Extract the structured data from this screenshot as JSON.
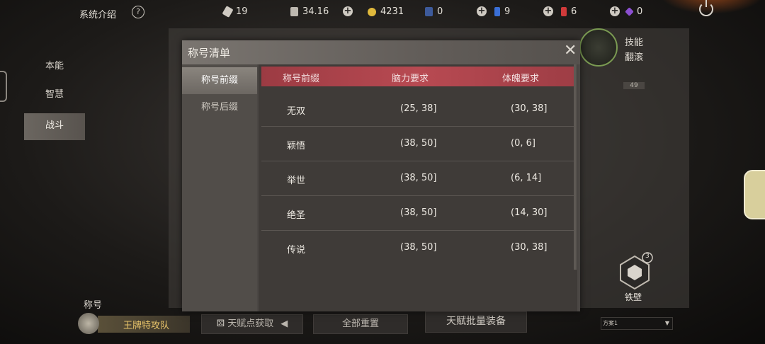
{
  "topbar": {
    "system_intro": "系统介绍",
    "help_icon": "?",
    "resources": [
      {
        "name": "fuel",
        "value": "19"
      },
      {
        "name": "ammo",
        "value": "34.16"
      },
      {
        "name": "gold",
        "value": "4231"
      },
      {
        "name": "card",
        "value": "0"
      },
      {
        "name": "blue-potion",
        "value": "9"
      },
      {
        "name": "red-potion",
        "value": "6"
      },
      {
        "name": "purple-crystal",
        "value": "0"
      }
    ]
  },
  "leftnav": {
    "items": [
      {
        "label": "本能"
      },
      {
        "label": "智慧"
      },
      {
        "label": "战斗"
      }
    ],
    "selected": "战斗"
  },
  "background": {
    "skill_title": "技能",
    "skill_name": "翻滚",
    "level": "49",
    "shield_name": "铁壁",
    "shield_badge": "3"
  },
  "bottom": {
    "title_label": "称号",
    "title_value": "王牌特攻队",
    "get_points": "天赋点获取",
    "reset_all": "全部重置",
    "batch_equip": "天赋批量装备",
    "scheme": "方案1"
  },
  "dialog": {
    "title": "称号清单",
    "tabs": [
      {
        "label": "称号前缀"
      },
      {
        "label": "称号后缀"
      }
    ],
    "selected_tab": "称号前缀",
    "columns": [
      "称号前缀",
      "脑力要求",
      "体魄要求"
    ],
    "rows": [
      {
        "name": "无双",
        "brain": "(25, 38]",
        "body": "(30, 38]"
      },
      {
        "name": "颖悟",
        "brain": "(38, 50]",
        "body": "(0, 6]"
      },
      {
        "name": "举世",
        "brain": "(38, 50]",
        "body": "(6, 14]"
      },
      {
        "name": "绝圣",
        "brain": "(38, 50]",
        "body": "(14, 30]"
      },
      {
        "name": "传说",
        "brain": "(38, 50]",
        "body": "(30, 38]"
      }
    ]
  },
  "colors": {
    "header_red": "#b84a52",
    "accent_gold": "#e8c46a",
    "skill_ring": "#7a9a52"
  }
}
